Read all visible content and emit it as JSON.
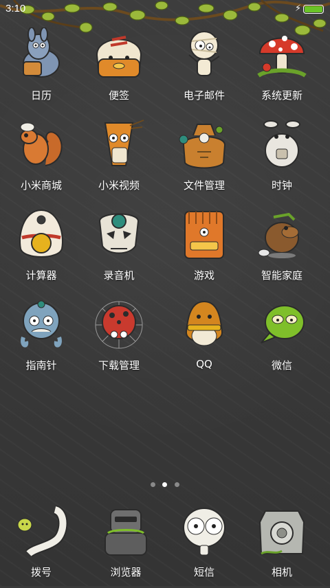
{
  "status_bar": {
    "time": "3:10",
    "battery_color": "#6ac427",
    "charging_icon": "lightning-bolt-icon"
  },
  "home": {
    "apps": [
      {
        "label": "日历",
        "icon": "donkey-calendar-icon"
      },
      {
        "label": "便签",
        "icon": "bandaged-head-notes-icon"
      },
      {
        "label": "电子邮件",
        "icon": "mummy-email-icon"
      },
      {
        "label": "系统更新",
        "icon": "mushroom-update-icon"
      },
      {
        "label": "小米商城",
        "icon": "squirrel-shop-icon"
      },
      {
        "label": "小米视频",
        "icon": "arrow-creature-video-icon"
      },
      {
        "label": "文件管理",
        "icon": "skull-sack-files-icon"
      },
      {
        "label": "时钟",
        "icon": "rabbit-clock-icon"
      },
      {
        "label": "计算器",
        "icon": "egg-calculator-icon"
      },
      {
        "label": "录音机",
        "icon": "skull-recorder-icon"
      },
      {
        "label": "游戏",
        "icon": "tiki-mask-games-icon"
      },
      {
        "label": "智能家庭",
        "icon": "beaver-smart-home-icon"
      },
      {
        "label": "指南针",
        "icon": "octopus-compass-icon"
      },
      {
        "label": "下载管理",
        "icon": "ladybug-web-download-icon"
      },
      {
        "label": "QQ",
        "icon": "penguin-qq-icon"
      },
      {
        "label": "微信",
        "icon": "green-blob-wechat-icon"
      }
    ]
  },
  "pager": {
    "pages": 3,
    "active": 2
  },
  "dock": {
    "apps": [
      {
        "label": "拨号",
        "icon": "horn-phone-icon"
      },
      {
        "label": "浏览器",
        "icon": "robot-browser-icon"
      },
      {
        "label": "短信",
        "icon": "skull-sms-icon"
      },
      {
        "label": "相机",
        "icon": "stone-camera-icon"
      }
    ]
  }
}
